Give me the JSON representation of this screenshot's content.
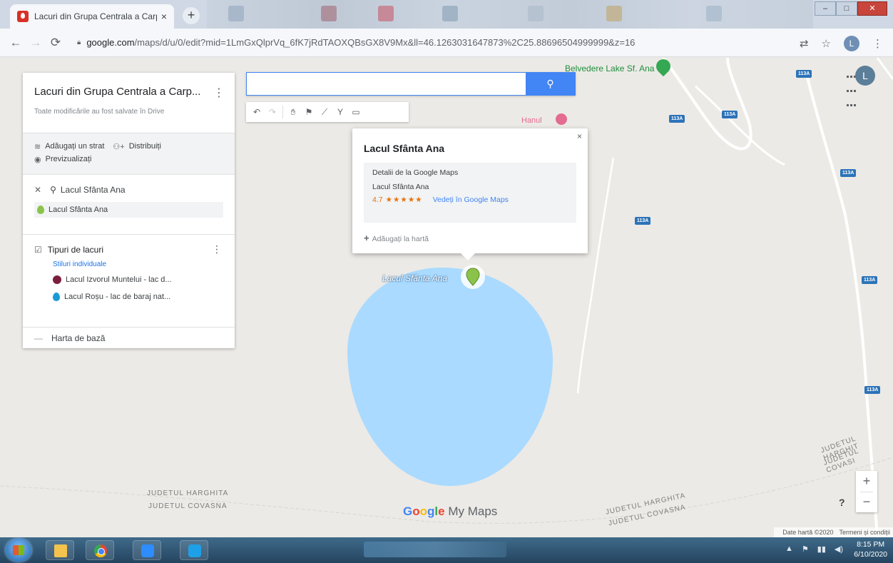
{
  "browser": {
    "tab_title": "Lacuri din Grupa Centrala a Carpa",
    "tab_close": "×",
    "new_tab": "+",
    "url_host": "google.com",
    "url_path": "/maps/d/u/0/edit?mid=1LmGxQlprVq_6fK7jRdTAOXQBsGX8V9Mx&ll=46.1263031647873%2C25.88696504999999&z=16",
    "profile_initial": "L",
    "win_minimize": "–",
    "win_maximize": "□",
    "win_close": "✕"
  },
  "map": {
    "account_initial": "L",
    "lake_label": "Lacul Sfânta Ana",
    "poi_belvedere": "Belvedere Lake Sf. Ana",
    "poi_hanul": "Hanul",
    "road_shield": "113A",
    "border_harghita": "JUDETUL HARGHITA",
    "border_covasna": "JUDETUL COVASNA",
    "border_covasna_short": "JUDETUL COVASI",
    "border_harghita_short": "JUDETUL HARGHIT",
    "logo_google": [
      "G",
      "o",
      "o",
      "g",
      "l",
      "e"
    ],
    "logo_mymaps": "My Maps",
    "zoom_in": "+",
    "zoom_out": "−",
    "help": "?",
    "map_data": "Date hartă ©2020",
    "terms": "Termeni și condiții"
  },
  "panel": {
    "title": "Lacuri din Grupa Centrala a Carp...",
    "menu": "⋮",
    "saved_status": "Toate modificările au fost salvate în Drive",
    "add_layer": "Adăugați un strat",
    "share": "Distribuiți",
    "preview": "Previzualizați",
    "search_layer_title": "Lacul Sfânta Ana",
    "search_result": "Lacul Sfânta Ana",
    "layer_title": "Tipuri de lacuri",
    "layer_style": "Stiluri individuale",
    "layer_items": [
      {
        "label": "Lacul Izvorul Muntelui - lac d...",
        "color": "#7b1e3d"
      },
      {
        "label": "Lacul Roșu - lac de baraj nat...",
        "color": "#1a9bd7"
      }
    ],
    "basemap": "Harta de bază"
  },
  "search": {
    "value": "",
    "placeholder": ""
  },
  "popup": {
    "title": "Lacul Sfânta Ana",
    "details_heading": "Detalii de la Google Maps",
    "place_name": "Lacul Sfânta Ana",
    "rating": "4.7",
    "stars": "★★★★★",
    "view_link": "Vedeți în Google Maps",
    "add_to_map": "Adăugați la hartă",
    "close": "×"
  },
  "taskbar": {
    "time": "8:15 PM",
    "date": "6/10/2020"
  },
  "colors": {
    "accent": "#4285f4",
    "lake": "#aadaff",
    "marker": "#8bc34a",
    "rating": "#e8710a"
  }
}
